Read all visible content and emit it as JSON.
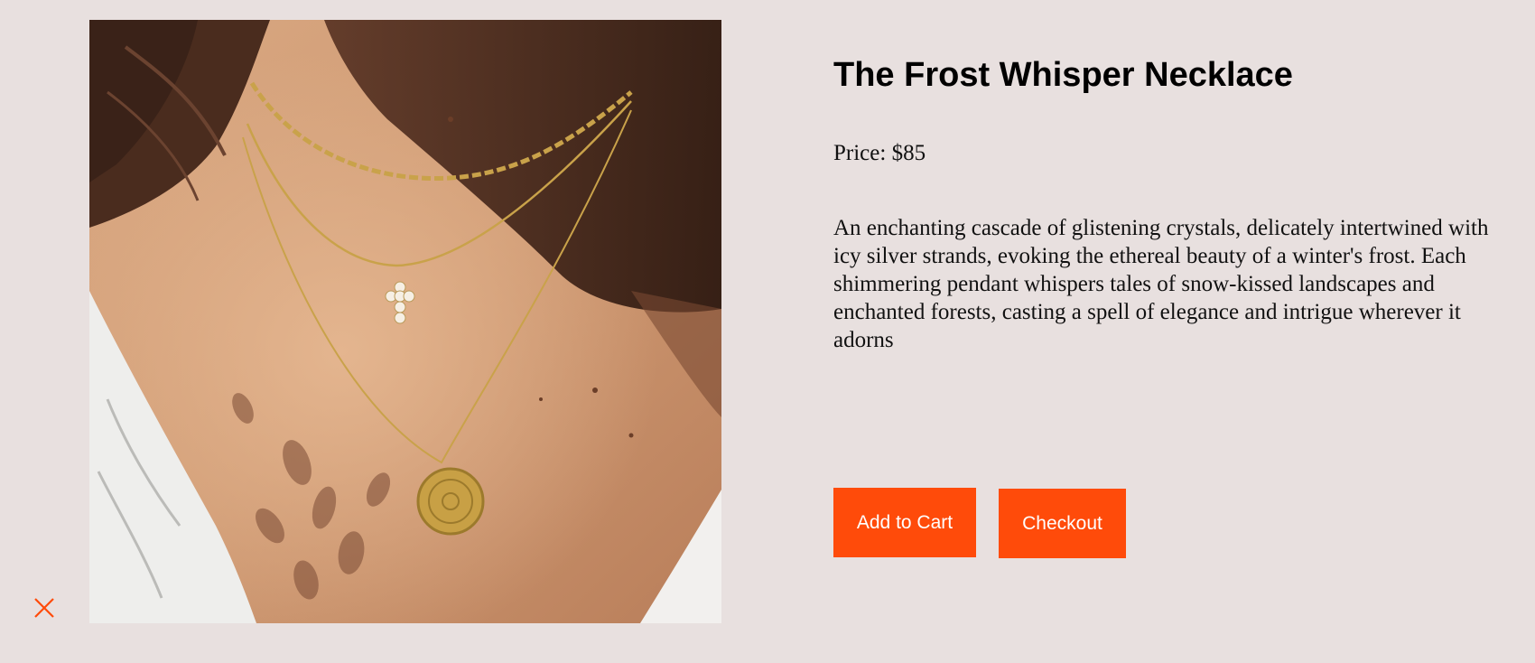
{
  "product": {
    "title": "The Frost Whisper Necklace",
    "price": "Price: $85",
    "description": "An enchanting cascade of glistening crystals, delicately intertwined with icy silver strands, evoking the ethereal beauty of a winter's frost. Each shimmering pendant whispers tales of snow-kissed landscapes and enchanted forests, casting a spell of elegance and intrigue wherever it adorns",
    "image_icon": "necklace-photo"
  },
  "actions": {
    "add_to_cart_label": "Add to Cart",
    "checkout_label": "Checkout"
  },
  "close": {
    "icon": "close-icon"
  },
  "colors": {
    "background": "#e8e0df",
    "accent": "#ff4b0a",
    "text": "#000000"
  }
}
